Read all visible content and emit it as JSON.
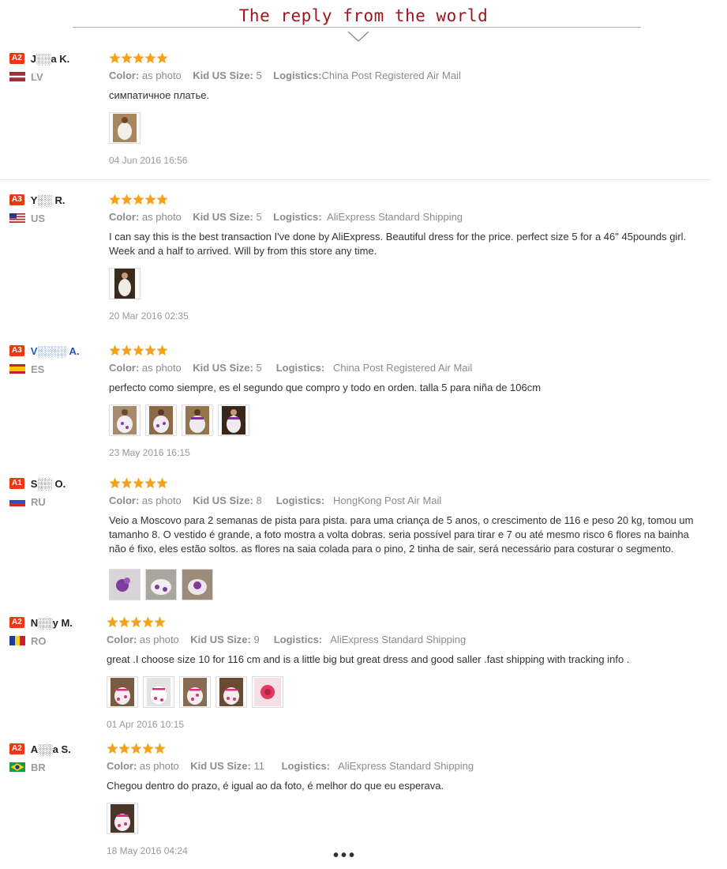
{
  "header": {
    "title": "The reply from the world"
  },
  "labels": {
    "color": "Color:",
    "size": "Kid US Size:",
    "logistics": "Logistics:"
  },
  "reviews": [
    {
      "level": "A2",
      "name": "J░░a K.",
      "country": "LV",
      "color": "as photo",
      "size": "5",
      "logistics": "China Post Registered Air Mail",
      "text": "симпатичное платье.",
      "date": "04 Jun 2016 16:56"
    },
    {
      "level": "A3",
      "name": "Y░░ R.",
      "country": "US",
      "color": "as photo",
      "size": "5",
      "logistics": "AliExpress Standard Shipping",
      "text": "I can say this is the best transaction I've done by AliExpress. Beautiful dress for the price. perfect size 5 for a 46\" 45pounds girl. Week and a half to arrived. Will by from this store any time.",
      "date": "20 Mar 2016 02:35"
    },
    {
      "level": "A3",
      "name": "V░░░░ A.",
      "country": "ES",
      "color": "as photo",
      "size": "5",
      "logistics": "China Post Registered Air Mail",
      "text": "perfecto como siempre, es el segundo que compro y todo en orden. talla 5 para niña de 106cm",
      "date": "23 May 2016 16:15"
    },
    {
      "level": "A1",
      "name": "S░░ O.",
      "country": "RU",
      "color": "as photo",
      "size": "8",
      "logistics": "HongKong Post Air Mail",
      "text": "Veio a Moscovo para 2 semanas de pista para pista. para uma criança de 5 anos, o crescimento de 116 e peso 20 kg, tomou um tamanho 8. O vestido é grande, a foto mostra a volta dobras. seria possível para tirar e 7 ou até mesmo risco 6 flores na bainha não é fixo, eles estão soltos. as flores na saia colada para o pino, 2 tinha de sair, será necessário para costurar o segmento.",
      "date": ""
    },
    {
      "level": "A2",
      "name": "N░░y M.",
      "country": "RO",
      "color": "as photo",
      "size": "9",
      "logistics": "AliExpress Standard Shipping",
      "text": "great .I choose size 10 for 116 cm and is a little big but great dress and good saller .fast shipping with tracking info .",
      "date": "01 Apr 2016 10:15"
    },
    {
      "level": "A2",
      "name": "A░░a S.",
      "country": "BR",
      "color": "as photo",
      "size": "11",
      "logistics": "AliExpress Standard Shipping",
      "text": "Chegou dentro do prazo, é igual ao da foto, é melhor do que eu esperava.",
      "date": "18 May 2016 04:24"
    }
  ],
  "more": "•••",
  "colors": {
    "title": "#a0141e",
    "star": "#f7a01a",
    "level_badge": "#e43b12",
    "name_blue": "#1a58c4"
  }
}
